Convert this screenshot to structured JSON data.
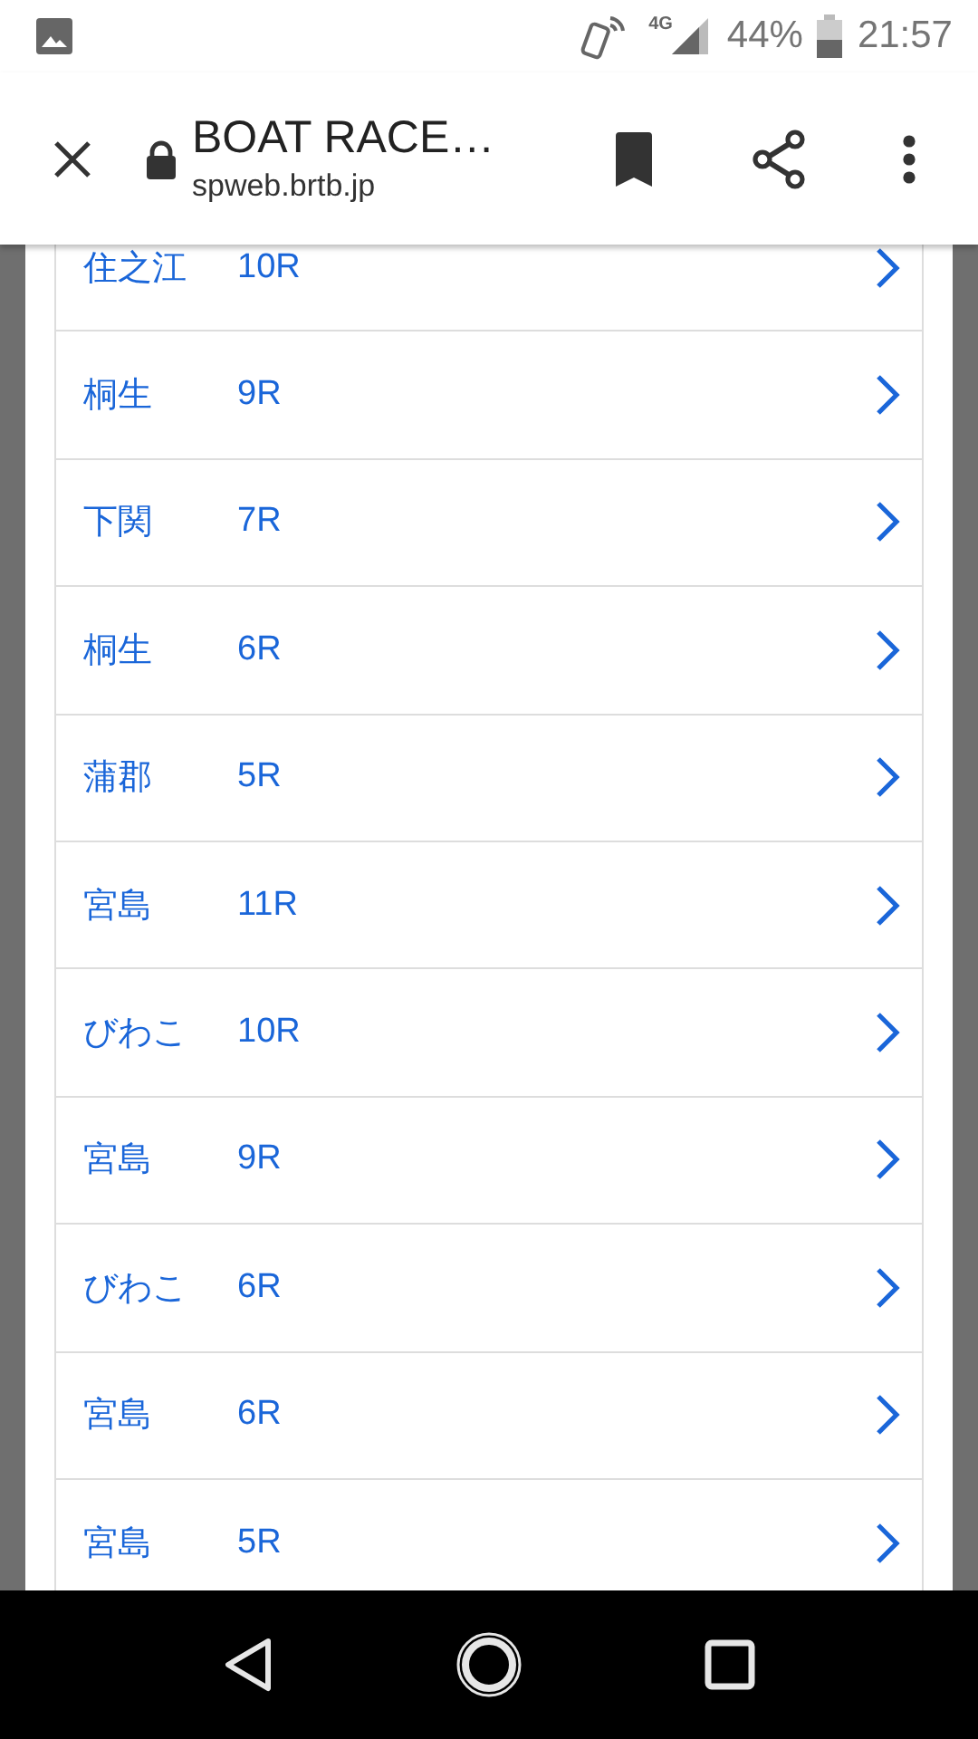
{
  "status_bar": {
    "network": "4G",
    "battery": "44%",
    "time": "21:57"
  },
  "toolbar": {
    "title": "BOAT RACE…",
    "url": "spweb.brtb.jp"
  },
  "races": [
    {
      "venue": "住之江",
      "race": "10R"
    },
    {
      "venue": "桐生",
      "race": "9R"
    },
    {
      "venue": "下関",
      "race": "7R"
    },
    {
      "venue": "桐生",
      "race": "6R"
    },
    {
      "venue": "蒲郡",
      "race": "5R"
    },
    {
      "venue": "宮島",
      "race": "11R"
    },
    {
      "venue": "びわこ",
      "race": "10R"
    },
    {
      "venue": "宮島",
      "race": "9R"
    },
    {
      "venue": "びわこ",
      "race": "6R"
    },
    {
      "venue": "宮島",
      "race": "6R"
    },
    {
      "venue": "宮島",
      "race": "5R"
    }
  ]
}
